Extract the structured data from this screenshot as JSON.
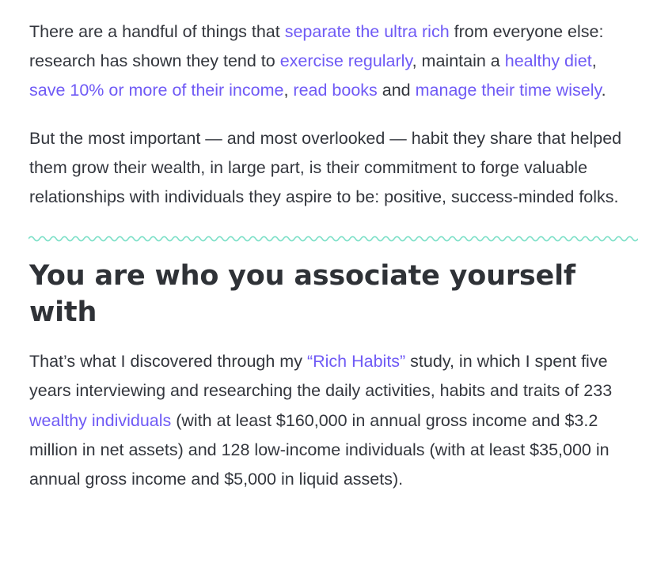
{
  "article": {
    "p1": {
      "t1": "There are a handful of things that ",
      "l1": "separate the ultra rich",
      "t2": " from everyone else: research has shown they tend to ",
      "l2": "exercise regularly",
      "t3": ", maintain a ",
      "l3": "healthy diet",
      "t4": ", ",
      "l4": "save 10% or more of their income",
      "t5": ", ",
      "l5": "read books",
      "t6": " and ",
      "l6": "manage their time wisely",
      "t7": "."
    },
    "p2": "But the most important — and most overlooked — habit they share that helped them grow their wealth, in large part, is their commitment to forge valuable relationships with individuals they aspire to be: positive, success-minded folks.",
    "heading": "You are who you associate yourself with",
    "p3": {
      "t1": "That’s what I discovered through my ",
      "l1": "“Rich Habits”",
      "t2": " study, in which I spent five years interviewing and researching the daily activities, habits and traits of 233 ",
      "l2": "wealthy individuals",
      "t3": " (with at least $160,000 in annual gross income and $3.2 million in net assets) and 128 low-income individuals (with at least $35,000 in annual gross income and $5,000 in liquid assets)."
    }
  },
  "colors": {
    "link": "#6f5af5",
    "text": "#33363d",
    "divider": "#7ee0c8"
  }
}
